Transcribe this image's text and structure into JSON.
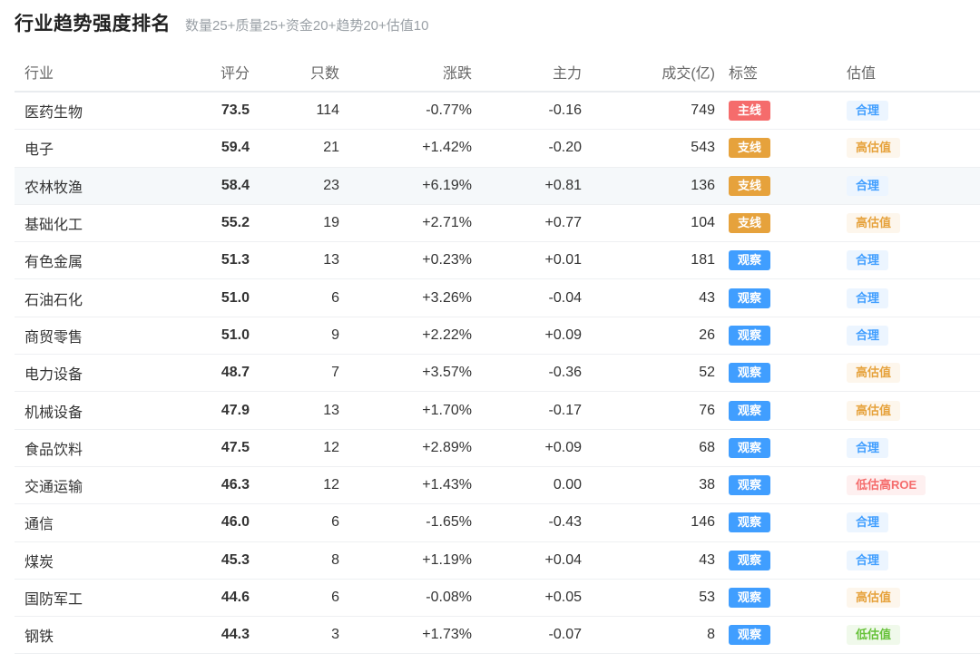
{
  "header": {
    "title": "行业趋势强度排名",
    "subtitle": "数量25+质量25+资金20+趋势20+估值10"
  },
  "table": {
    "columns": [
      "行业",
      "评分",
      "只数",
      "涨跌",
      "主力",
      "成交(亿)",
      "标签",
      "估值"
    ],
    "rows": [
      {
        "name": "医药生物",
        "score": "73.5",
        "count": "114",
        "change": "-0.77%",
        "main": "-0.16",
        "volume": "749",
        "tag": "主线",
        "tag_type": "main",
        "valuation": "合理",
        "val_type": "fair"
      },
      {
        "name": "电子",
        "score": "59.4",
        "count": "21",
        "change": "+1.42%",
        "main": "-0.20",
        "volume": "543",
        "tag": "支线",
        "tag_type": "branch",
        "valuation": "高估值",
        "val_type": "high"
      },
      {
        "name": "农林牧渔",
        "score": "58.4",
        "count": "23",
        "change": "+6.19%",
        "main": "+0.81",
        "volume": "136",
        "tag": "支线",
        "tag_type": "branch",
        "valuation": "合理",
        "val_type": "fair"
      },
      {
        "name": "基础化工",
        "score": "55.2",
        "count": "19",
        "change": "+2.71%",
        "main": "+0.77",
        "volume": "104",
        "tag": "支线",
        "tag_type": "branch",
        "valuation": "高估值",
        "val_type": "high"
      },
      {
        "name": "有色金属",
        "score": "51.3",
        "count": "13",
        "change": "+0.23%",
        "main": "+0.01",
        "volume": "181",
        "tag": "观察",
        "tag_type": "watch",
        "valuation": "合理",
        "val_type": "fair"
      },
      {
        "name": "石油石化",
        "score": "51.0",
        "count": "6",
        "change": "+3.26%",
        "main": "-0.04",
        "volume": "43",
        "tag": "观察",
        "tag_type": "watch",
        "valuation": "合理",
        "val_type": "fair"
      },
      {
        "name": "商贸零售",
        "score": "51.0",
        "count": "9",
        "change": "+2.22%",
        "main": "+0.09",
        "volume": "26",
        "tag": "观察",
        "tag_type": "watch",
        "valuation": "合理",
        "val_type": "fair"
      },
      {
        "name": "电力设备",
        "score": "48.7",
        "count": "7",
        "change": "+3.57%",
        "main": "-0.36",
        "volume": "52",
        "tag": "观察",
        "tag_type": "watch",
        "valuation": "高估值",
        "val_type": "high"
      },
      {
        "name": "机械设备",
        "score": "47.9",
        "count": "13",
        "change": "+1.70%",
        "main": "-0.17",
        "volume": "76",
        "tag": "观察",
        "tag_type": "watch",
        "valuation": "高估值",
        "val_type": "high"
      },
      {
        "name": "食品饮料",
        "score": "47.5",
        "count": "12",
        "change": "+2.89%",
        "main": "+0.09",
        "volume": "68",
        "tag": "观察",
        "tag_type": "watch",
        "valuation": "合理",
        "val_type": "fair"
      },
      {
        "name": "交通运输",
        "score": "46.3",
        "count": "12",
        "change": "+1.43%",
        "main": "0.00",
        "volume": "38",
        "tag": "观察",
        "tag_type": "watch",
        "valuation": "低估高ROE",
        "val_type": "lowroe"
      },
      {
        "name": "通信",
        "score": "46.0",
        "count": "6",
        "change": "-1.65%",
        "main": "-0.43",
        "volume": "146",
        "tag": "观察",
        "tag_type": "watch",
        "valuation": "合理",
        "val_type": "fair"
      },
      {
        "name": "煤炭",
        "score": "45.3",
        "count": "8",
        "change": "+1.19%",
        "main": "+0.04",
        "volume": "43",
        "tag": "观察",
        "tag_type": "watch",
        "valuation": "合理",
        "val_type": "fair"
      },
      {
        "name": "国防军工",
        "score": "44.6",
        "count": "6",
        "change": "-0.08%",
        "main": "+0.05",
        "volume": "53",
        "tag": "观察",
        "tag_type": "watch",
        "valuation": "高估值",
        "val_type": "high"
      },
      {
        "name": "钢铁",
        "score": "44.3",
        "count": "3",
        "change": "+1.73%",
        "main": "-0.07",
        "volume": "8",
        "tag": "观察",
        "tag_type": "watch",
        "valuation": "低估值",
        "val_type": "low"
      }
    ]
  },
  "colors": {
    "tag_main": "#f56c6c",
    "tag_branch": "#e6a23c",
    "tag_watch": "#409eff",
    "val_fair": "#409eff",
    "val_high": "#e6a23c",
    "val_lowroe": "#f56c6c",
    "val_low": "#67c23a"
  }
}
